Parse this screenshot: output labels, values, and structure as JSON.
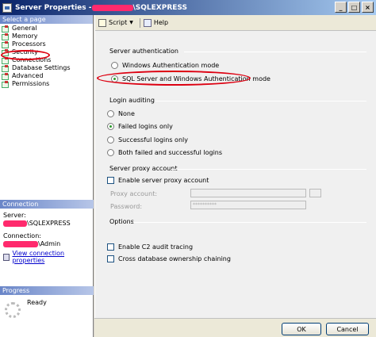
{
  "window": {
    "title_prefix": "Server Properties - ",
    "title_suffix": "\\SQLEXPRESS",
    "minimize": "_",
    "maximize": "□",
    "close": "×"
  },
  "sidebar": {
    "select_page": "Select a page",
    "items": [
      {
        "label": "General"
      },
      {
        "label": "Memory"
      },
      {
        "label": "Processors"
      },
      {
        "label": "Security"
      },
      {
        "label": "Connections"
      },
      {
        "label": "Database Settings"
      },
      {
        "label": "Advanced"
      },
      {
        "label": "Permissions"
      }
    ],
    "connection_header": "Connection",
    "server_label": "Server:",
    "server_value": "\\SQLEXPRESS",
    "connection_label": "Connection:",
    "connection_value": "\\Admin",
    "view_link": "View connection properties",
    "progress_header": "Progress",
    "progress_status": "Ready"
  },
  "toolbar": {
    "script_label": "Script",
    "help_label": "Help"
  },
  "server_auth": {
    "title": "Server authentication",
    "windows_mode": "Windows Authentication mode",
    "mixed_mode": "SQL Server and Windows Authentication mode"
  },
  "login_auditing": {
    "title": "Login auditing",
    "none": "None",
    "failed": "Failed logins only",
    "successful": "Successful logins only",
    "both": "Both failed and successful logins"
  },
  "proxy": {
    "title": "Server proxy account",
    "enable": "Enable server proxy account",
    "account_label": "Proxy account:",
    "password_label": "Password:",
    "password_value": "**********"
  },
  "options": {
    "title": "Options",
    "c2": "Enable C2 audit tracing",
    "cross_db": "Cross database ownership chaining"
  },
  "footer": {
    "ok": "OK",
    "cancel": "Cancel"
  }
}
